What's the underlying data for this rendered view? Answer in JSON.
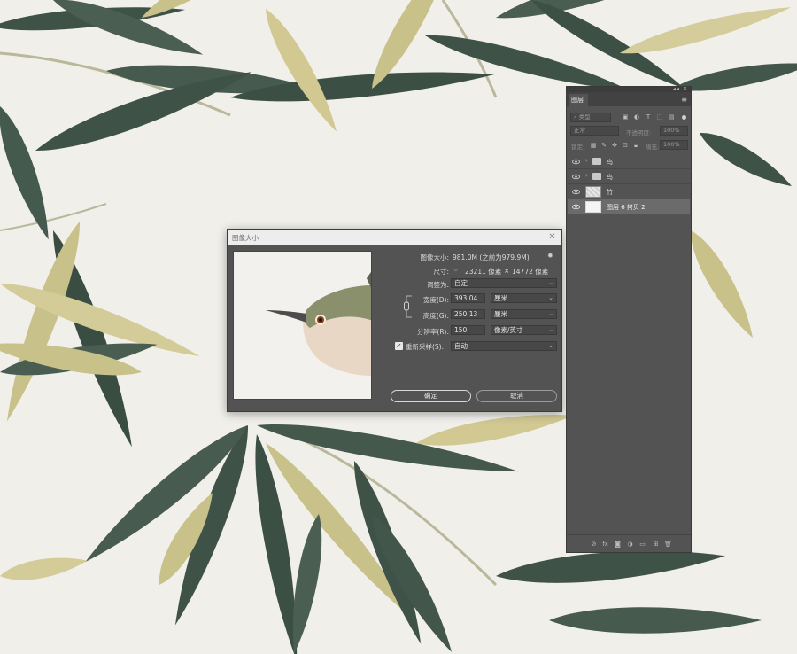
{
  "dialog": {
    "title": "图像大小",
    "image_size_label": "图像大小:",
    "image_size_value": "981.0M (之前为979.9M)",
    "dimensions_label": "尺寸:",
    "dimensions_width": "23211 像素",
    "dimensions_x": "×",
    "dimensions_height": "14772 像素",
    "fit_to_label": "调整为:",
    "fit_to_value": "自定",
    "width_label": "宽度(D):",
    "width_value": "393.04",
    "width_unit": "厘米",
    "height_label": "高度(G):",
    "height_value": "250.13",
    "height_unit": "厘米",
    "resolution_label": "分辨率(R):",
    "resolution_value": "150",
    "resolution_unit": "像素/英寸",
    "resample_label": "重新采样(S):",
    "resample_value": "自动",
    "resample_checked": true,
    "ok_label": "确定",
    "cancel_label": "取消"
  },
  "layers_panel": {
    "tab_label": "图层",
    "filter_placeholder": "类型",
    "blend_mode": "正常",
    "opacity_label": "不透明度:",
    "opacity_value": "100%",
    "lock_label": "锁定:",
    "fill_label": "填充:",
    "fill_value": "100%",
    "layers": [
      {
        "name": "鸟",
        "type": "group",
        "visible": true,
        "selected": false
      },
      {
        "name": "鸟",
        "type": "group",
        "visible": true,
        "selected": false
      },
      {
        "name": "竹",
        "type": "pixel",
        "visible": true,
        "selected": false
      },
      {
        "name": "图层 6 拷贝 2",
        "type": "pixel",
        "visible": true,
        "selected": true
      }
    ]
  },
  "colors": {
    "panel_bg": "#535353",
    "canvas_bg": "#f1efea",
    "leaf_dark": "#3f5248",
    "leaf_yellow": "#c9c18a"
  }
}
